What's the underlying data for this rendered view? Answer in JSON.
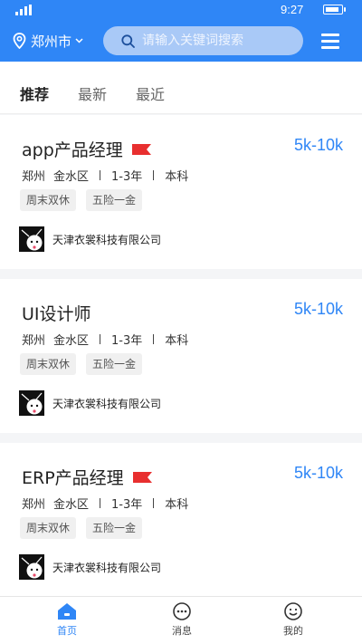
{
  "status_bar": {
    "time": "9:27"
  },
  "header": {
    "city": "郑州市",
    "search_placeholder": "请输入关键词搜索",
    "accent_color": "#2f86f6"
  },
  "tabs": [
    {
      "label": "推荐",
      "active": true
    },
    {
      "label": "最新",
      "active": false
    },
    {
      "label": "最近",
      "active": false
    }
  ],
  "jobs": [
    {
      "title": "app产品经理",
      "flag": true,
      "salary": "5k-10k",
      "city": "郑州",
      "district": "金水区",
      "experience": "1-3年",
      "education": "本科",
      "tags": [
        "周末双休",
        "五险一金"
      ],
      "company": "天津衣裳科技有限公司"
    },
    {
      "title": "UI设计师",
      "flag": false,
      "salary": "5k-10k",
      "city": "郑州",
      "district": "金水区",
      "experience": "1-3年",
      "education": "本科",
      "tags": [
        "周末双休",
        "五险一金"
      ],
      "company": "天津衣裳科技有限公司"
    },
    {
      "title": "ERP产品经理",
      "flag": true,
      "salary": "5k-10k",
      "city": "郑州",
      "district": "金水区",
      "experience": "1-3年",
      "education": "本科",
      "tags": [
        "周末双休",
        "五险一金"
      ],
      "company": "天津衣裳科技有限公司"
    }
  ],
  "bottom_nav": [
    {
      "label": "首页",
      "icon": "home-icon",
      "active": true
    },
    {
      "label": "消息",
      "icon": "message-icon",
      "active": false
    },
    {
      "label": "我的",
      "icon": "profile-icon",
      "active": false
    }
  ]
}
